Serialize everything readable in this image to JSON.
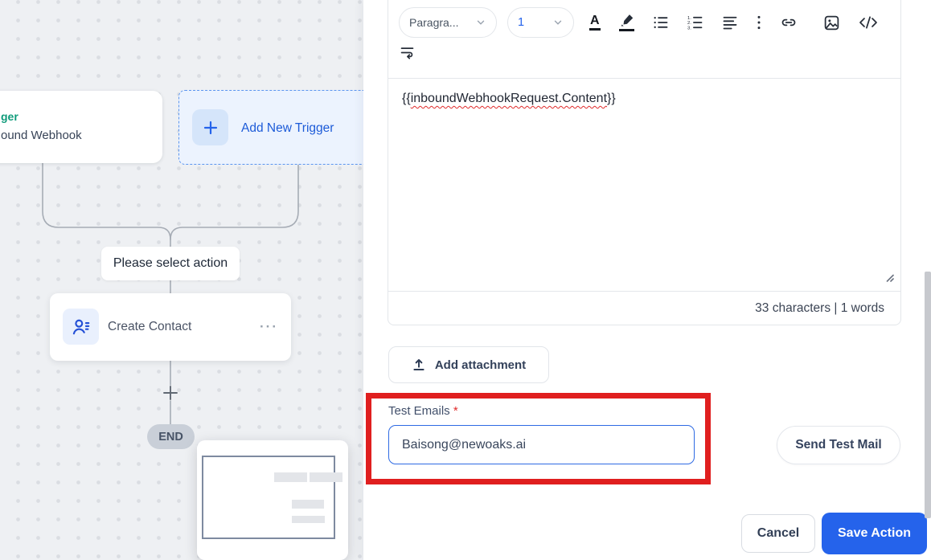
{
  "canvas": {
    "trigger_card": {
      "title": "ger",
      "subtitle": "ound Webhook"
    },
    "add_new_trigger": {
      "label": "Add New Trigger"
    },
    "select_action_label": "Please select action",
    "create_contact": {
      "label": "Create Contact",
      "menu": "···"
    },
    "end_badge": "END"
  },
  "editor": {
    "toolbar": {
      "paragraph_dropdown": "Paragra...",
      "size_dropdown": "1",
      "text_color_letter": "A"
    },
    "content_prefix": "{{",
    "content_variable": "inboundWebhookRequest.Content",
    "content_suffix": "}}",
    "counter": "33 characters | 1 words"
  },
  "attachment": {
    "label": "Add attachment"
  },
  "test_emails": {
    "label": "Test Emails",
    "required": "*",
    "value": "Baisong@newoaks.ai"
  },
  "send_test_mail": {
    "label": "Send Test Mail"
  },
  "actions": {
    "cancel": "Cancel",
    "save": "Save Action"
  },
  "icons": [
    "plus-icon",
    "ellipsis-menu-icon",
    "contact-icon",
    "chevron-down-icon",
    "text-color-icon",
    "highlighter-icon",
    "bullet-list-icon",
    "numbered-list-icon",
    "align-icon",
    "kebab-icon",
    "link-icon",
    "image-icon",
    "code-icon",
    "wrap-text-icon",
    "upload-icon",
    "resize-handle-icon"
  ],
  "colors": {
    "accent_blue": "#2563eb",
    "annotation_red": "#e01f1f",
    "trigger_green": "#0f9b7a",
    "canvas_bg": "#eef0f3"
  }
}
